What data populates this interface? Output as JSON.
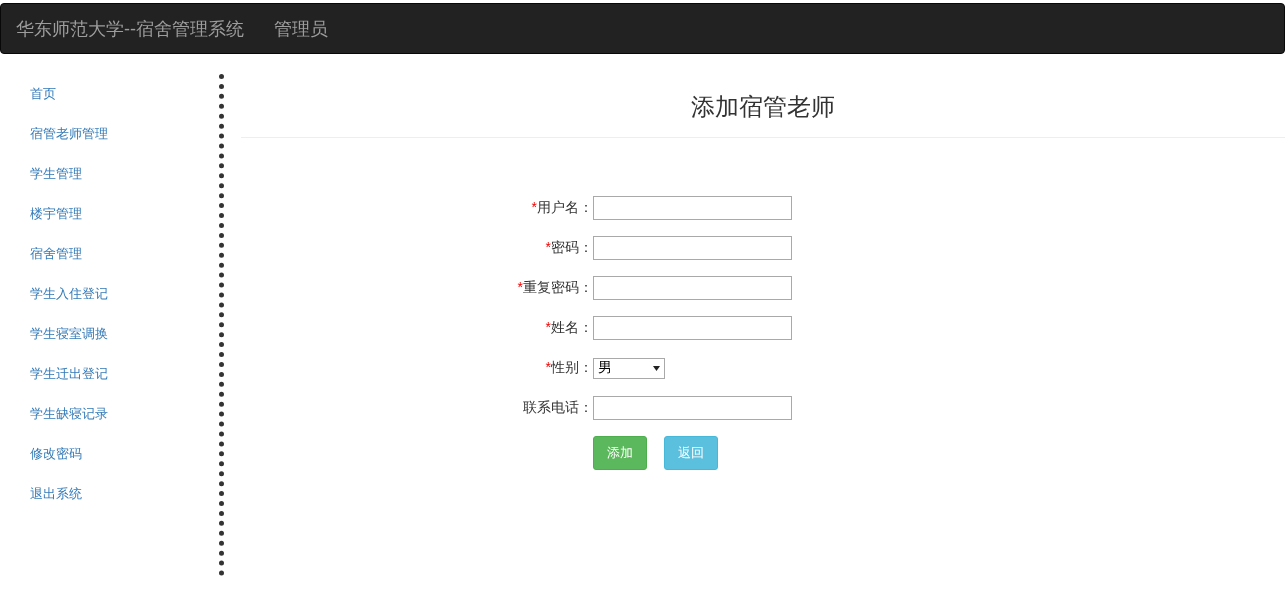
{
  "navbar": {
    "brand": "华东师范大学--宿舍管理系统",
    "user": "管理员"
  },
  "sidebar": {
    "items": [
      {
        "label": "首页"
      },
      {
        "label": "宿管老师管理"
      },
      {
        "label": "学生管理"
      },
      {
        "label": "楼宇管理"
      },
      {
        "label": "宿舍管理"
      },
      {
        "label": "学生入住登记"
      },
      {
        "label": "学生寝室调换"
      },
      {
        "label": "学生迁出登记"
      },
      {
        "label": "学生缺寝记录"
      },
      {
        "label": "修改密码"
      },
      {
        "label": "退出系统"
      }
    ]
  },
  "page": {
    "title": "添加宿管老师"
  },
  "form": {
    "fields": [
      {
        "kind": "text",
        "required_mark": "*",
        "label": "用户名："
      },
      {
        "kind": "password",
        "required_mark": "*",
        "label": "密码："
      },
      {
        "kind": "password",
        "required_mark": "*",
        "label": "重复密码："
      },
      {
        "kind": "text",
        "required_mark": "*",
        "label": "姓名："
      },
      {
        "kind": "select",
        "required_mark": "*",
        "label": "性别：",
        "value": "男"
      },
      {
        "kind": "text",
        "label": "联系电话："
      }
    ],
    "buttons": [
      {
        "kind": "primary",
        "label": "添加"
      },
      {
        "kind": "secondary",
        "label": "返回"
      }
    ]
  }
}
